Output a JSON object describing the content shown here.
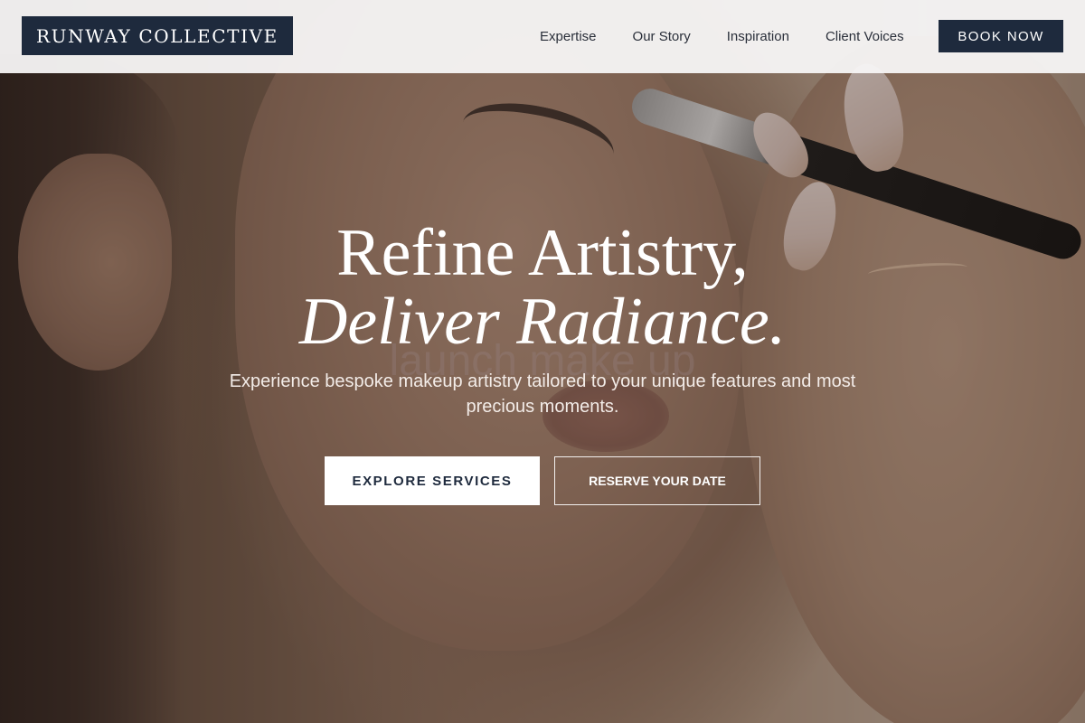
{
  "brand": {
    "name": "RUNWAY COLLECTIVE"
  },
  "nav": {
    "items": [
      {
        "label": "Expertise"
      },
      {
        "label": "Our Story"
      },
      {
        "label": "Inspiration"
      },
      {
        "label": "Client Voices"
      }
    ],
    "cta_label": "BOOK NOW"
  },
  "hero": {
    "headline_line1": "Refine Artistry,",
    "headline_line2": "Deliver Radiance.",
    "ghost_text": "launch make up",
    "subtext": "Experience bespoke makeup artistry tailored to your unique features and most precious moments.",
    "primary_button": "EXPLORE SERVICES",
    "secondary_button": "RESERVE YOUR DATE",
    "background_image": "makeup-artist-applying-brush-to-woman-profile"
  },
  "colors": {
    "navy": "#1e2a3d",
    "header_bg": "#f7f6f5",
    "white": "#ffffff"
  }
}
